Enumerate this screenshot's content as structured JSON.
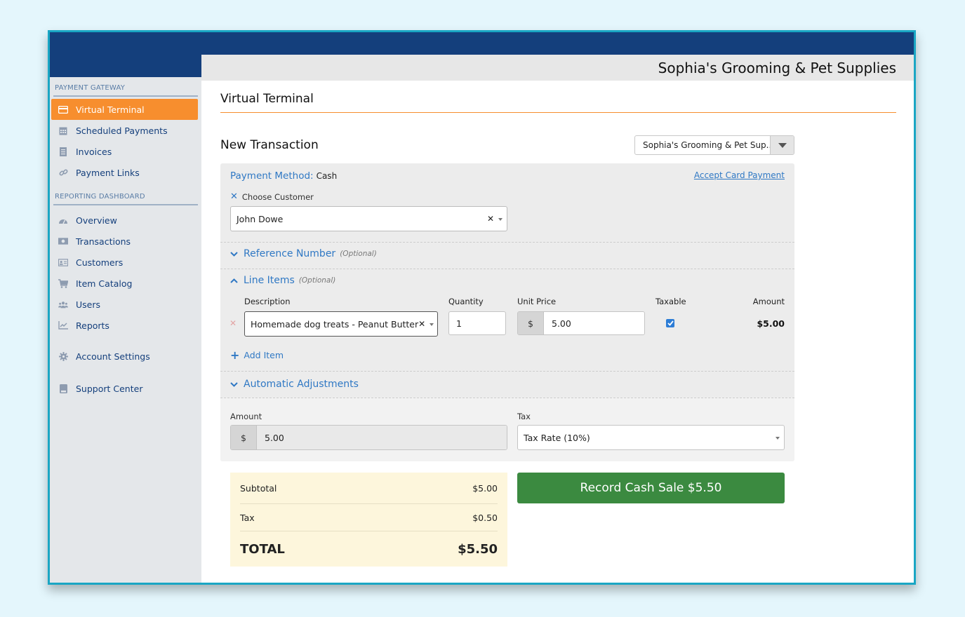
{
  "header": {
    "business_name": "Sophia's Grooming & Pet Supplies"
  },
  "sidebar": {
    "sections": [
      {
        "title": "PAYMENT GATEWAY",
        "items": [
          {
            "label": "Virtual Terminal",
            "icon": "card-icon",
            "active": true
          },
          {
            "label": "Scheduled Payments",
            "icon": "calendar-icon"
          },
          {
            "label": "Invoices",
            "icon": "invoice-icon"
          },
          {
            "label": "Payment Links",
            "icon": "link-icon"
          }
        ]
      },
      {
        "title": "REPORTING DASHBOARD",
        "items": [
          {
            "label": "Overview",
            "icon": "dashboard-icon"
          },
          {
            "label": "Transactions",
            "icon": "money-icon"
          },
          {
            "label": "Customers",
            "icon": "id-card-icon"
          },
          {
            "label": "Item Catalog",
            "icon": "cart-icon"
          },
          {
            "label": "Users",
            "icon": "users-icon"
          },
          {
            "label": "Reports",
            "icon": "chart-icon"
          }
        ]
      }
    ],
    "extra_items": [
      {
        "label": "Account Settings",
        "icon": "gear-icon"
      },
      {
        "label": "Support Center",
        "icon": "book-icon"
      }
    ]
  },
  "page": {
    "title": "Virtual Terminal",
    "subtitle": "New Transaction",
    "merchant_select": "Sophia's Grooming & Pet Sup..."
  },
  "payment": {
    "method_label": "Payment Method:",
    "method_value": "Cash",
    "accept_card_link": "Accept Card Payment",
    "choose_customer_label": "Choose Customer",
    "customer_value": "John Dowe"
  },
  "sections": {
    "reference": {
      "label": "Reference Number",
      "optional": "(Optional)"
    },
    "line_items": {
      "label": "Line Items",
      "optional": "(Optional)"
    },
    "adjustments": {
      "label": "Automatic Adjustments"
    }
  },
  "line_items": {
    "headers": {
      "description": "Description",
      "quantity": "Quantity",
      "unit_price": "Unit Price",
      "taxable": "Taxable",
      "amount": "Amount"
    },
    "rows": [
      {
        "description": "Homemade dog treats - Peanut Butter",
        "quantity": "1",
        "currency": "$",
        "unit_price": "5.00",
        "taxable": true,
        "amount": "$5.00"
      }
    ],
    "add_item": "Add Item"
  },
  "totals_form": {
    "amount_label": "Amount",
    "amount_currency": "$",
    "amount_value": "5.00",
    "tax_label": "Tax",
    "tax_value": "Tax Rate (10%)"
  },
  "summary": {
    "subtotal_label": "Subtotal",
    "subtotal_value": "$5.00",
    "tax_label": "Tax",
    "tax_value": "$0.50",
    "total_label": "TOTAL",
    "total_value": "$5.50"
  },
  "record_button": "Record Cash Sale $5.50",
  "colors": {
    "navy": "#143f7c",
    "accent_orange": "#f78e2e",
    "link_blue": "#2f78c4",
    "success_green": "#3b8a40",
    "frame_border": "#1aa6c4"
  }
}
